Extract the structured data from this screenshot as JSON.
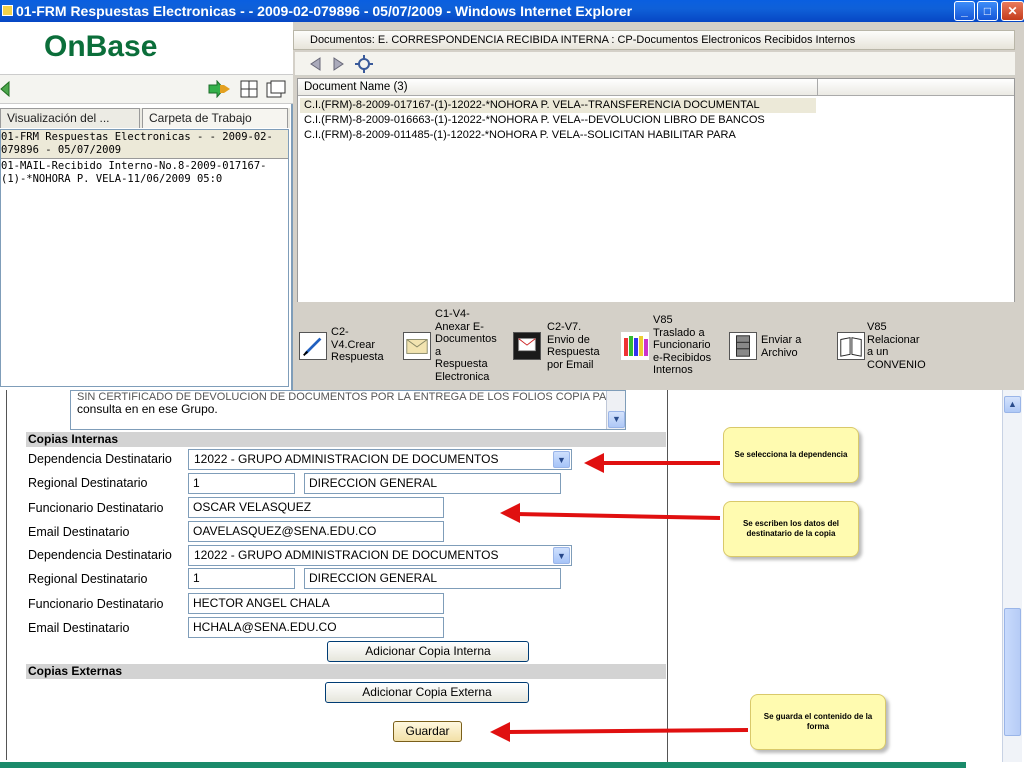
{
  "window": {
    "title": "01-FRM Respuestas Electronicas - - 2009-02-079896 - 05/07/2009 - Windows Internet Explorer",
    "min_label": "_",
    "max_label": "□",
    "close_label": "✕"
  },
  "left_pane": {
    "logo": "OnBase",
    "tabs": [
      "Visualización del ...",
      "Carpeta de Trabajo"
    ],
    "items": [
      "01-FRM Respuestas Electronicas - - 2009-02-\n079896 - 05/07/2009",
      "01-MAIL-Recibido Interno-No.8-2009-017167-\n(1)-*NOHORA P. VELA-11/06/2009 05:0"
    ]
  },
  "documents": {
    "header": "Documentos: E. CORRESPONDENCIA RECIBIDA INTERNA : CP-Documentos Electronicos Recibidos Internos",
    "column": "Document Name (3)",
    "rows": [
      "C.I.(FRM)-8-2009-017167-(1)-12022-*NOHORA P. VELA--TRANSFERENCIA DOCUMENTAL",
      "C.I.(FRM)-8-2009-016663-(1)-12022-*NOHORA P. VELA--DEVOLUCION LIBRO DE BANCOS",
      "C.I.(FRM)-8-2009-011485-(1)-12022-*NOHORA P. VELA--SOLICITAN HABILITAR PARA"
    ],
    "actions": [
      {
        "label": "C2-\nV4.Crear\nRespuesta",
        "icon": "pen-icon"
      },
      {
        "label": "C1-V4-\nAnexar E-\nDocumentos\na\nRespuesta\nElectronica",
        "icon": "envelope-icon"
      },
      {
        "label": "C2-V7.\nEnvio de\nRespuesta\npor Email",
        "icon": "email-icon"
      },
      {
        "label": "V85\nTraslado a\nFuncionario\ne-Recibidos\nInternos",
        "icon": "crayons-icon"
      },
      {
        "label": "Enviar a\nArchivo",
        "icon": "cabinet-icon"
      },
      {
        "label": "V85\nRelacionar\na un\nCONVENIO",
        "icon": "book-icon"
      }
    ]
  },
  "form": {
    "textarea_text": "consulta en en ese Grupo.",
    "textarea_text_partial": "SIN CERTIFICADO DE DEVOLUCION DE DOCUMENTOS POR LA ENTREGA DE LOS FOLIOS COPIA PARA SU",
    "copias_internas": "Copias Internas",
    "copias_externas": "Copias Externas",
    "labels": {
      "dependencia": "Dependencia Destinatario",
      "regional": "Regional Destinatario",
      "funcionario": "Funcionario Destinatario",
      "email": "Email Destinatario"
    },
    "copy1": {
      "dependencia": "12022 - GRUPO ADMINISTRACION DE DOCUMENTOS",
      "regional_code": "1",
      "regional_name": "DIRECCION GENERAL",
      "funcionario": "OSCAR VELASQUEZ",
      "email": "OAVELASQUEZ@SENA.EDU.CO"
    },
    "copy2": {
      "dependencia": "12022 - GRUPO ADMINISTRACION DE DOCUMENTOS",
      "regional_code": "1",
      "regional_name": "DIRECCION GENERAL",
      "funcionario": "HECTOR ANGEL CHALA",
      "email": "HCHALA@SENA.EDU.CO"
    },
    "add_interna": "Adicionar Copia Interna",
    "add_externa": "Adicionar Copia Externa",
    "save": "Guardar"
  },
  "callouts": {
    "c1": "Se selecciona la dependencia",
    "c2": "Se escriben los datos del destinatario de la copia",
    "c3": "Se guarda el contenido de la forma"
  },
  "colors": {
    "title_bar": "#0a5fe0",
    "onbase_green": "#0b6e3a",
    "arrow_red": "#e01010",
    "callout_yellow": "#fffbb0"
  }
}
